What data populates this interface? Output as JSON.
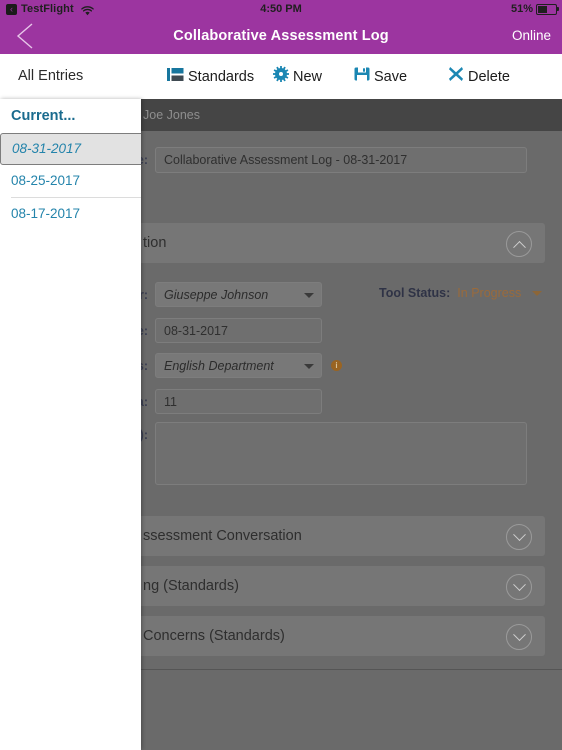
{
  "status_bar": {
    "app_name": "TestFlight",
    "back_glyph": "‹",
    "wifi_icon": "wifi-icon",
    "time": "4:50 PM",
    "battery_pct": "51%"
  },
  "nav_bar": {
    "back_icon": "chevron-left-icon",
    "title": "Collaborative Assessment Log",
    "connection_status": "Online"
  },
  "toolbar": {
    "all_entries": "All Entries",
    "standards": "Standards",
    "new": "New",
    "save": "Save",
    "delete": "Delete"
  },
  "content_header": {
    "user": "Joe Jones"
  },
  "form": {
    "name_label": "me:",
    "name_value": "Collaborative Assessment Log - 08-31-2017",
    "section_information": "tion",
    "evaluator_label": "or:",
    "evaluator_value": "Giuseppe Johnson",
    "tool_status_label": "Tool Status:",
    "tool_status_value": "In Progress",
    "date_label": "te:",
    "date_value": "08-31-2017",
    "tags_label": "gs:",
    "tags_value": "English Department",
    "tags_info_icon": "info-icon",
    "area_label": "ea:",
    "area_value": "11",
    "notes_label": "s):",
    "notes_value": ""
  },
  "sections": [
    {
      "title": "ssessment Conversation",
      "state": "collapsed"
    },
    {
      "title": "ng (Standards)",
      "state": "collapsed"
    },
    {
      "title": "Concerns (Standards)",
      "state": "collapsed"
    }
  ],
  "entries_popover": {
    "header": "Current...",
    "items": [
      {
        "date": "08-31-2017",
        "selected": true
      },
      {
        "date": "08-25-2017",
        "selected": false
      },
      {
        "date": "08-17-2017",
        "selected": false
      }
    ]
  },
  "colors": {
    "brand_purple": "#9c35a0",
    "accent_teal": "#1a7fa8",
    "link_blue": "#2484ab",
    "status_amber": "#9a6b3c",
    "dim_overlay": "#6a6a6a"
  }
}
